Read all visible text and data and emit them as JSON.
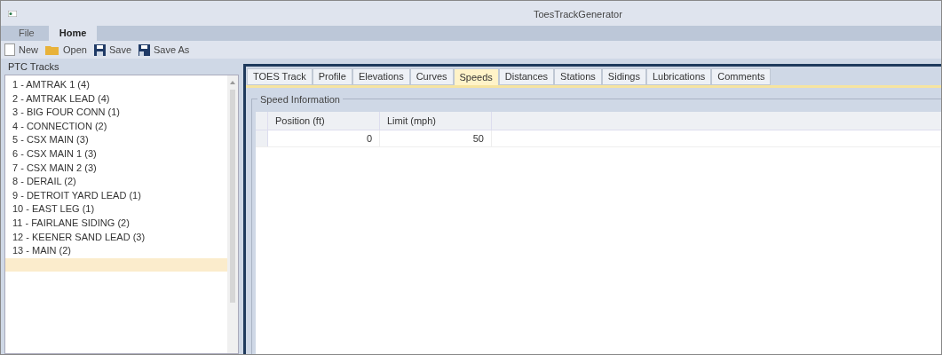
{
  "window": {
    "title": "ToesTrackGenerator"
  },
  "ribbon_tabs": [
    {
      "label": "File",
      "selected": false
    },
    {
      "label": "Home",
      "selected": true
    }
  ],
  "toolbar": [
    {
      "kind": "new",
      "label": "New"
    },
    {
      "kind": "open",
      "label": "Open"
    },
    {
      "kind": "save",
      "label": "Save"
    },
    {
      "kind": "saveas",
      "label": "Save As"
    }
  ],
  "tracks": {
    "title": "PTC Tracks",
    "items": [
      {
        "label": "1 - AMTRAK 1 (4)",
        "selected": false
      },
      {
        "label": "2 - AMTRAK LEAD (4)",
        "selected": false
      },
      {
        "label": "3 - BIG FOUR CONN (1)",
        "selected": false
      },
      {
        "label": "4 - CONNECTION (2)",
        "selected": false
      },
      {
        "label": "5 - CSX MAIN (3)",
        "selected": false
      },
      {
        "label": "6 - CSX MAIN 1 (3)",
        "selected": false
      },
      {
        "label": "7 - CSX MAIN 2 (3)",
        "selected": false
      },
      {
        "label": "8 - DERAIL (2)",
        "selected": false
      },
      {
        "label": "9 - DETROIT YARD LEAD (1)",
        "selected": false
      },
      {
        "label": "10 - EAST LEG (1)",
        "selected": false
      },
      {
        "label": "11 - FAIRLANE SIDING (2)",
        "selected": false
      },
      {
        "label": "12 - KEENER SAND LEAD (3)",
        "selected": false
      },
      {
        "label": "13 - MAIN (2)",
        "selected": false
      },
      {
        "selected": true
      }
    ]
  },
  "tabs": [
    {
      "label": "TOES Track",
      "selected": false
    },
    {
      "label": "Profile",
      "selected": false
    },
    {
      "label": "Elevations",
      "selected": false
    },
    {
      "label": "Curves",
      "selected": false
    },
    {
      "label": "Speeds",
      "selected": true
    },
    {
      "label": "Distances",
      "selected": false
    },
    {
      "label": "Stations",
      "selected": false
    },
    {
      "label": "Sidings",
      "selected": false
    },
    {
      "label": "Lubrications",
      "selected": false
    },
    {
      "label": "Comments",
      "selected": false
    }
  ],
  "speed_group": {
    "title": "Speed Information",
    "columns": [
      "Position (ft)",
      "Limit (mph)"
    ],
    "rows": [
      [
        "0",
        "50"
      ]
    ]
  }
}
